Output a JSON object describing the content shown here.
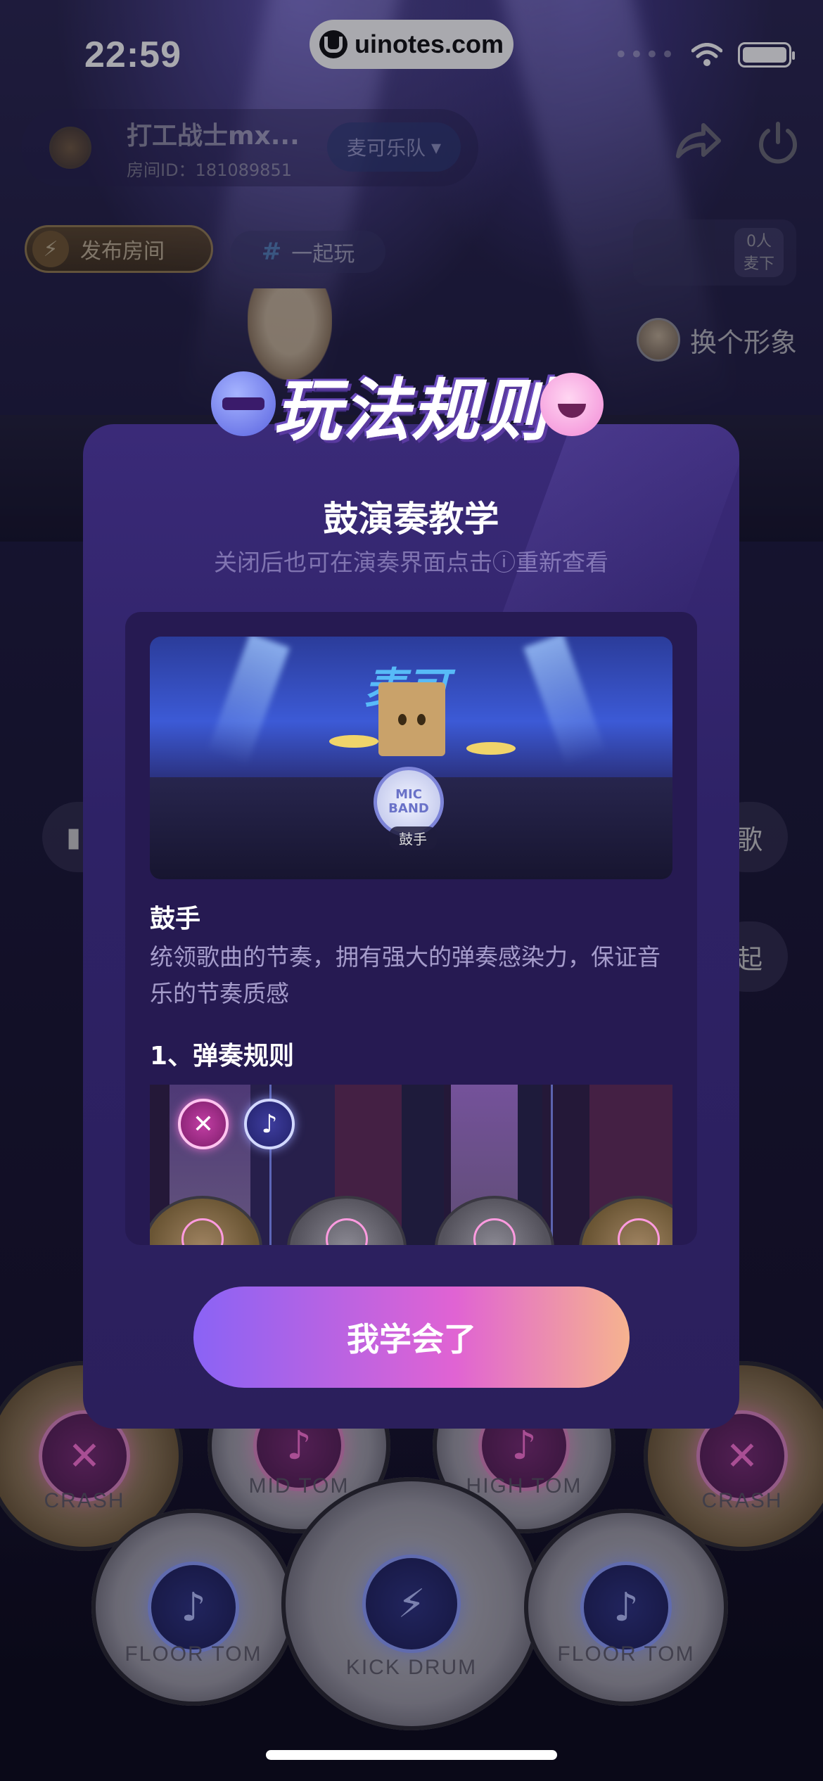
{
  "status_bar": {
    "time": "22:59",
    "url": "uinotes.com"
  },
  "room": {
    "name": "打工战士mx...",
    "room_id": "房间ID：181089851",
    "band_tag": "麦可乐队",
    "share_icon": "share-icon",
    "power_icon": "power-icon"
  },
  "actions": {
    "publish_label": "发布房间",
    "play_tag_label": "一起玩",
    "play_tag_hash": "#",
    "mic_count": "0人",
    "mic_status": "麦下",
    "change_avatar_label": "换个形象",
    "side_left_icon": "bars-icon",
    "side_right_top": "歌",
    "side_right_bottom": "起"
  },
  "modal": {
    "banner_title": "玩法规则",
    "title": "鼓演奏教学",
    "subtitle": "关闭后也可在演奏界面点击ⓘ重新查看",
    "illustration_logo": "麦可",
    "illustration_drum_text": "MIC BAND",
    "illustration_tag": "鼓手",
    "role_title": "鼓手",
    "role_desc": "统领歌曲的节奏，拥有强大的弹奏感染力，保证音乐的节奏质感",
    "rule_title": "1、弹奏规则",
    "confirm_button": "我学会了"
  },
  "drums": [
    {
      "label": "CRASH",
      "symbol": "✕",
      "kind": "crash"
    },
    {
      "label": "MID TOM",
      "symbol": "♪",
      "kind": "tom"
    },
    {
      "label": "HIGH TOM",
      "symbol": "♪",
      "kind": "tom"
    },
    {
      "label": "CRASH",
      "symbol": "✕",
      "kind": "crash"
    },
    {
      "label": "FLOOR TOM",
      "symbol": "♪",
      "kind": "floor"
    },
    {
      "label": "KICK DRUM",
      "symbol": "⚡",
      "kind": "kick"
    },
    {
      "label": "FLOOR TOM",
      "symbol": "♪",
      "kind": "floor"
    }
  ],
  "colors": {
    "modal_bg": "#2e2266",
    "button_gradient_start": "#8a63f5",
    "button_gradient_mid": "#e063d3",
    "button_gradient_end": "#f6b38f",
    "publish_gold": "#b89a52"
  }
}
